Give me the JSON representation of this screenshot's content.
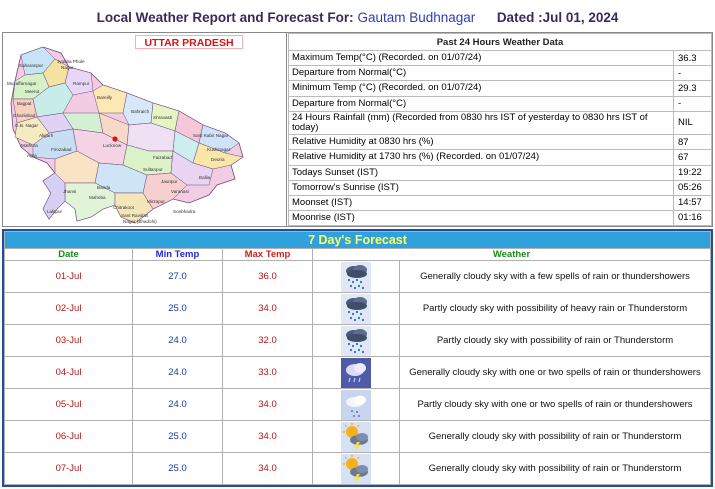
{
  "header": {
    "prefix": "Local Weather Report and Forecast For:",
    "location": "Gautam Budhnagar",
    "dated": "Dated :Jul 01, 2024"
  },
  "map": {
    "state_label": "UTTAR PRADESH",
    "region_color": "#f0c8e0",
    "state_label_color": "#d81414",
    "district_labels": [
      "Saharanpur",
      "Jyotiba Phule",
      "Nagar",
      "Muzaffarnagar",
      "Meerut",
      "Bagpat",
      "Rampur",
      "Bareilly",
      "Ghaziabad",
      "G.B. Nagar",
      "Aligarh",
      "Mathura",
      "Agra",
      "Firozabad",
      "Shravasti",
      "Bahraich",
      "Sant Kabir Nagar",
      "Kushinagar",
      "Lucknow",
      "Faizabad",
      "Deoria",
      "Sultanpur",
      "Jaunpur",
      "Ballia",
      "Varanasi",
      "Mirzapur",
      "Sonbhadra",
      "Jhansi",
      "Mahoba",
      "Chitrakoot",
      "Sant Ravidas",
      "Nagar (Bhadohi)",
      "Lalitpur",
      "Banda"
    ]
  },
  "past24": {
    "heading": "Past 24 Hours Weather Data",
    "rows": [
      {
        "label": "Maximum Temp(°C) (Recorded. on 01/07/24)",
        "value": "36.3"
      },
      {
        "label": "Departure from Normal(°C)",
        "value": "-"
      },
      {
        "label": "Minimum Temp (°C) (Recorded. on 01/07/24)",
        "value": "29.3"
      },
      {
        "label": "Departure from Normal(°C)",
        "value": "-"
      },
      {
        "label": "24 Hours Rainfall (mm) (Recorded from 0830 hrs IST of yesterday to 0830 hrs IST of today)",
        "value": "NIL"
      },
      {
        "label": "Relative Humidity at 0830 hrs (%)",
        "value": "87"
      },
      {
        "label": "Relative Humidity at 1730 hrs (%) (Recorded. on 01/07/24)",
        "value": "67"
      },
      {
        "label": "Todays Sunset (IST)",
        "value": "19:22"
      },
      {
        "label": "Tomorrow's Sunrise (IST)",
        "value": "05:26"
      },
      {
        "label": "Moonset (IST)",
        "value": "14:57"
      },
      {
        "label": "Moonrise (IST)",
        "value": "01:16"
      }
    ]
  },
  "forecast": {
    "title": "7 Day's Forecast",
    "columns": {
      "date": "Date",
      "min": "Min Temp",
      "max": "Max Temp",
      "weather": "Weather"
    },
    "rows": [
      {
        "date": "01-Jul",
        "min": "27.0",
        "max": "36.0",
        "icon": "thunderstorm-rain-icon",
        "desc": "Generally cloudy sky with a few spells of rain or thundershowers"
      },
      {
        "date": "02-Jul",
        "min": "25.0",
        "max": "34.0",
        "icon": "thunderstorm-rain-icon",
        "desc": "Partly cloudy sky with possibility of heavy rain or Thunderstorm"
      },
      {
        "date": "03-Jul",
        "min": "24.0",
        "max": "32.0",
        "icon": "thunderstorm-rain-icon",
        "desc": "Partly cloudy sky with possibility of rain or Thunderstorm"
      },
      {
        "date": "04-Jul",
        "min": "24.0",
        "max": "33.0",
        "icon": "night-rain-icon",
        "desc": "Generally cloudy sky with one or two spells of rain or thundershowers"
      },
      {
        "date": "05-Jul",
        "min": "24.0",
        "max": "34.0",
        "icon": "light-rain-icon",
        "desc": "Partly cloudy sky with one or two spells of rain or thundershowers"
      },
      {
        "date": "06-Jul",
        "min": "25.0",
        "max": "34.0",
        "icon": "sun-thunder-cloud-icon",
        "desc": "Generally cloudy sky with possibility of rain or Thunderstorm"
      },
      {
        "date": "07-Jul",
        "min": "25.0",
        "max": "34.0",
        "icon": "sun-thunder-cloud-icon",
        "desc": "Generally cloudy sky with possibility of rain or Thunderstorm"
      }
    ]
  }
}
